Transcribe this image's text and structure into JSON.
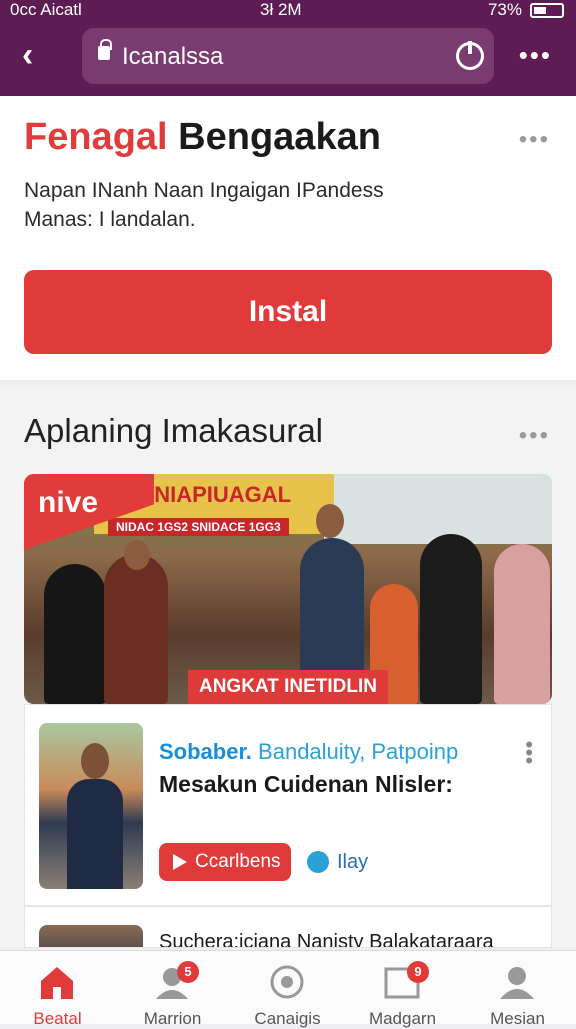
{
  "status": {
    "carrier": "0cc Aicatl",
    "time": "3ł 2M",
    "battery": "73%"
  },
  "browser": {
    "url": "Icanalssa"
  },
  "card": {
    "title_red": "Fenagal",
    "title_black": "Bengaakan",
    "description": "Napan INanh Naan Ingaigan IPandess Manas: I landalan.",
    "install_label": "Instal"
  },
  "section": {
    "title": "Aplaning Imakasural",
    "photo": {
      "corner_label": "nive",
      "sign": "MANIAPIUAGAL",
      "sign_small": "NIDAC 1GS2 SNIDACE 1GG3",
      "badge": "ANGKAT INETIDLIN"
    },
    "item": {
      "subtitle_a": "Sobaber.",
      "subtitle_b": "Bandaluity, Patpoinp",
      "headline": "Mesakun Cuidenan Nlisler:",
      "cta_label": "Ccarlbens",
      "secondary_label": "Ilay"
    },
    "item2": {
      "headline": "Suchera:iciana Nanisty Balakataraara"
    }
  },
  "nav": [
    {
      "label": "Beatal",
      "icon": "home-icon",
      "badge": ""
    },
    {
      "label": "Marrion",
      "icon": "profile-notification-icon",
      "badge": "5"
    },
    {
      "label": "Canaigis",
      "icon": "settings-gear-icon",
      "badge": ""
    },
    {
      "label": "Madgarn",
      "icon": "message-box-icon",
      "badge": "9"
    },
    {
      "label": "Mesian",
      "icon": "user-icon",
      "badge": ""
    }
  ],
  "colors": {
    "header": "#5e1c54",
    "accent_red": "#e03a3a",
    "accent_blue": "#1a8fd6"
  }
}
